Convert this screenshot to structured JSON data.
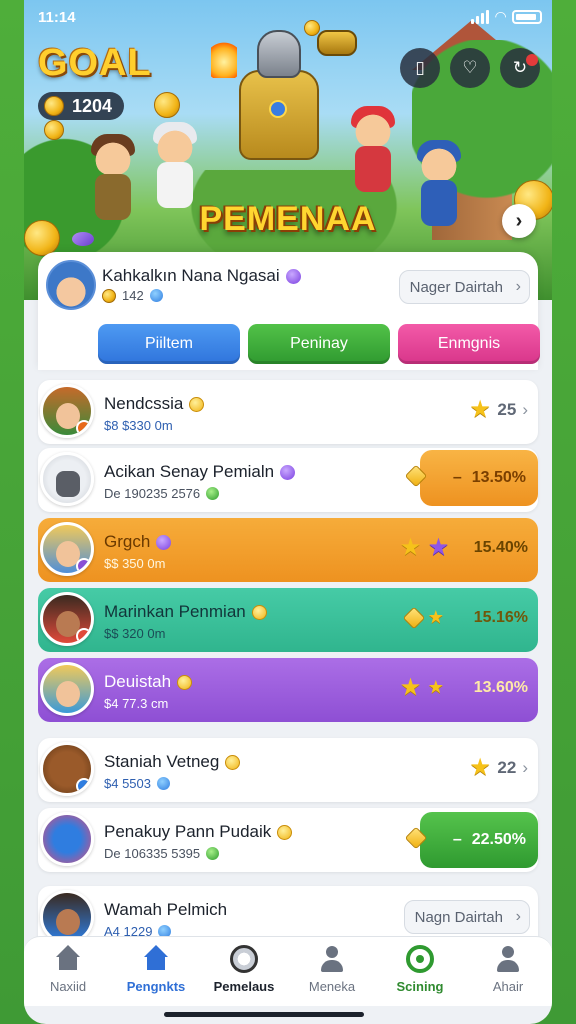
{
  "status_bar": {
    "time": "11:14"
  },
  "hero": {
    "logo": "GOAL",
    "coins": "1204",
    "banner": "PEMENAA"
  },
  "profile": {
    "name": "Kahkalkın Nana Ngasai",
    "coins": "142",
    "button": "Nager Dairtah"
  },
  "tabs": [
    "Piiltem",
    "Peninay",
    "Enmgnis"
  ],
  "rows": [
    {
      "name": "Nendcssia",
      "sub": "$8 $330 0m",
      "right": "25"
    },
    {
      "name": "Acikan Senay Pemialn",
      "sub": "De 190235 2576",
      "pct": "13.50%"
    },
    {
      "name": "Grgch",
      "sub": "$$ 350 0m",
      "pct": "15.40%"
    },
    {
      "name": "Marinkan Penmian",
      "sub": "$$ 320 0m",
      "pct": "15.16%"
    },
    {
      "name": "Deuistah",
      "sub": "$4 77.3 cm",
      "pct": "13.60%"
    },
    {
      "name": "Staniah Vetneg",
      "sub": "$4 5503",
      "right": "22"
    },
    {
      "name": "Penakuy Pann Pudaik",
      "sub": "De 106335 5395",
      "pct": "22.50%"
    },
    {
      "name": "Wamah Pelmich",
      "sub": "A4 1229",
      "button": "Nagn Dairtah"
    }
  ],
  "nav": [
    {
      "label": "Naxiid",
      "icon": "home-icon"
    },
    {
      "label": "Pengnkts",
      "icon": "home-icon"
    },
    {
      "label": "Pemelaus",
      "icon": "soccer-ball-icon"
    },
    {
      "label": "Meneka",
      "icon": "person-icon"
    },
    {
      "label": "Scining",
      "icon": "ring-icon"
    },
    {
      "label": "Ahair",
      "icon": "person-icon"
    }
  ],
  "colors": {
    "accent_blue": "#2f74dc",
    "accent_green": "#2f9a30",
    "accent_pink": "#d8358a",
    "row_orange": "#ee9220",
    "row_teal": "#30b58e",
    "row_purple": "#8e4fd4"
  }
}
